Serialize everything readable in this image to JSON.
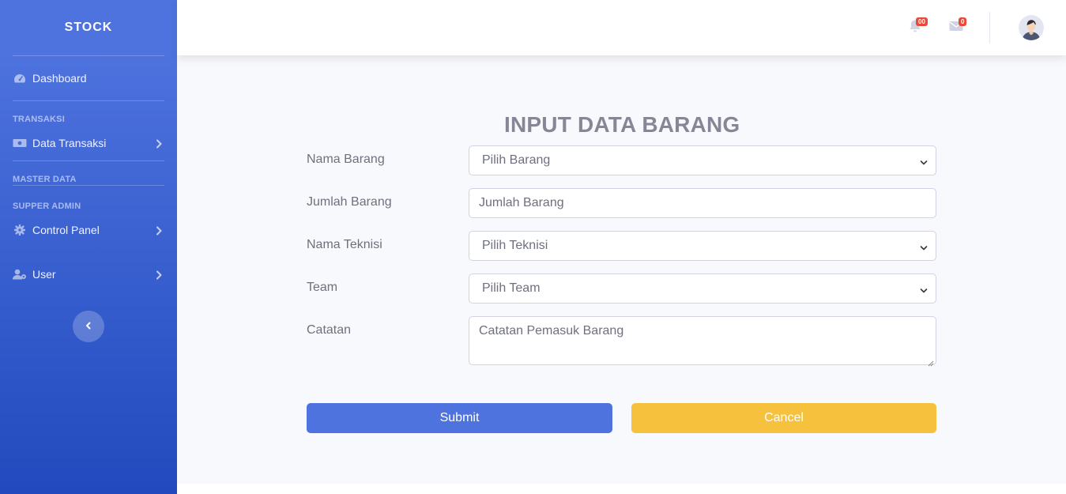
{
  "sidebar": {
    "brand": "STOCK",
    "dashboard_label": "Dashboard",
    "section_transaksi": "TRANSAKSI",
    "data_transaksi_label": "Data Transaksi",
    "section_master": "MASTER DATA",
    "section_supper": "SUPPER ADMIN",
    "control_panel_label": "Control Panel",
    "user_label": "User",
    "icons": [
      "tachometer-icon",
      "money-bill-icon",
      "cog-icon",
      "user-cog-icon",
      "chevron-right-icon",
      "chevron-left-icon"
    ]
  },
  "topbar": {
    "alerts_count": "00",
    "messages_count": "0"
  },
  "form": {
    "title": "INPUT DATA BARANG",
    "nama_barang_label": "Nama Barang",
    "nama_barang_value": "Pilih Barang",
    "jumlah_barang_label": "Jumlah Barang",
    "jumlah_barang_placeholder": "Jumlah Barang",
    "nama_teknisi_label": "Nama Teknisi",
    "nama_teknisi_value": "Pilih Teknisi",
    "team_label": "Team",
    "team_value": "Pilih Team",
    "catatan_label": "Catatan",
    "catatan_placeholder": "Catatan Pemasuk Barang",
    "submit_label": "Submit",
    "cancel_label": "Cancel"
  },
  "colors": {
    "primary": "#4e73df",
    "warning": "#f6c23e",
    "danger": "#e74a3b",
    "text_muted": "#858796"
  }
}
